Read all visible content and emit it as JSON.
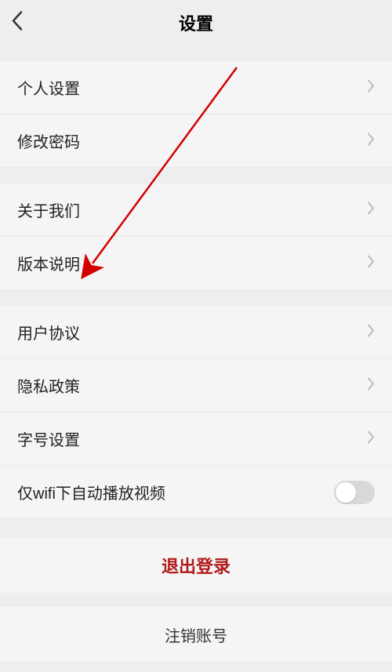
{
  "header": {
    "title": "设置"
  },
  "group1": [
    {
      "label": "个人设置"
    },
    {
      "label": "修改密码"
    }
  ],
  "group2": [
    {
      "label": "关于我们"
    },
    {
      "label": "版本说明"
    }
  ],
  "group3": [
    {
      "label": "用户协议"
    },
    {
      "label": "隐私政策"
    },
    {
      "label": "字号设置"
    },
    {
      "label": "仅wifi下自动播放视频",
      "toggle": true,
      "state": false
    }
  ],
  "actions": {
    "logout": "退出登录",
    "delete": "注销账号"
  },
  "annotation": {
    "arrow_color": "#d40000"
  }
}
